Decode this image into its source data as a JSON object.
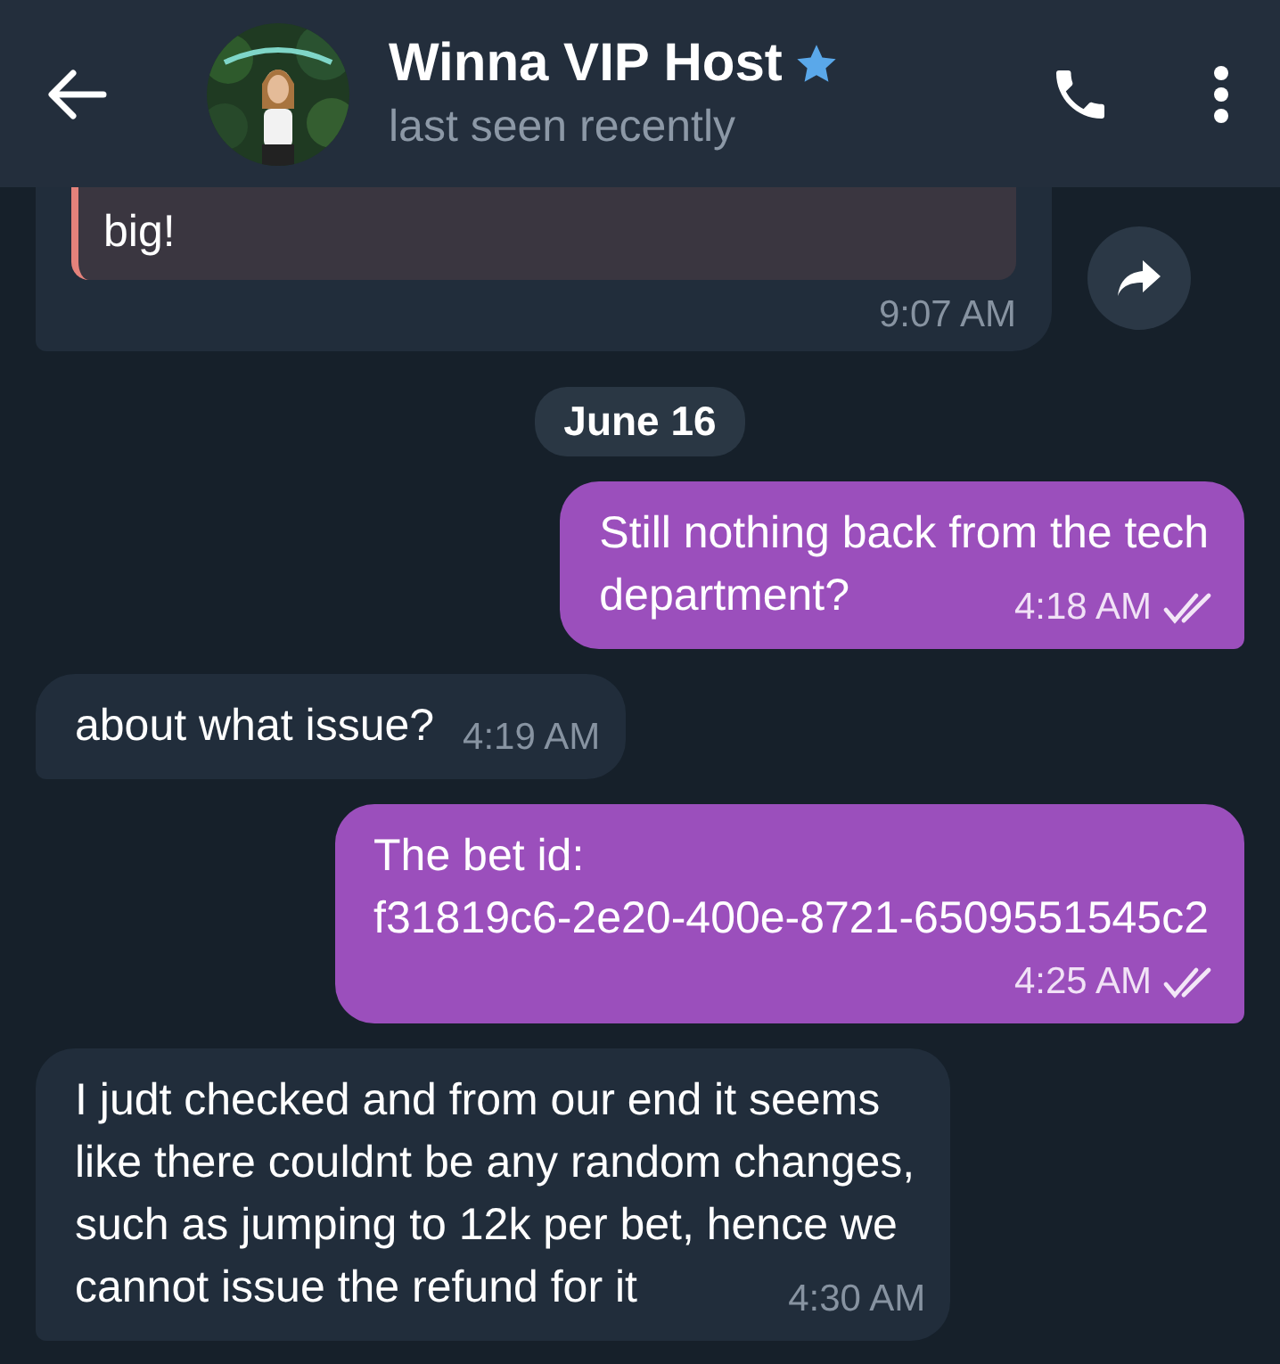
{
  "header": {
    "title": "Winna VIP Host",
    "verified": true,
    "status": "last seen recently"
  },
  "messages": [
    {
      "kind": "incoming",
      "quote": "big!",
      "time": "9:07 AM",
      "forward_button": true
    },
    {
      "kind": "date",
      "text": "June 16"
    },
    {
      "kind": "outgoing",
      "lines": [
        "Still nothing back from the tech",
        "department?"
      ],
      "time": "4:18 AM",
      "read": true
    },
    {
      "kind": "incoming",
      "lines": [
        "about what issue?"
      ],
      "time": "4:19 AM"
    },
    {
      "kind": "outgoing",
      "lines": [
        "The bet id:",
        "f31819c6-2e20-400e-8721-6509551545c2"
      ],
      "time": "4:25 AM",
      "read": true
    },
    {
      "kind": "incoming",
      "lines": [
        "I judt checked and from our end it seems",
        "like there couldnt be any random changes,",
        "such as jumping to 12k per bet, hence we",
        "cannot issue the refund for it"
      ],
      "time": "4:30 AM"
    }
  ]
}
